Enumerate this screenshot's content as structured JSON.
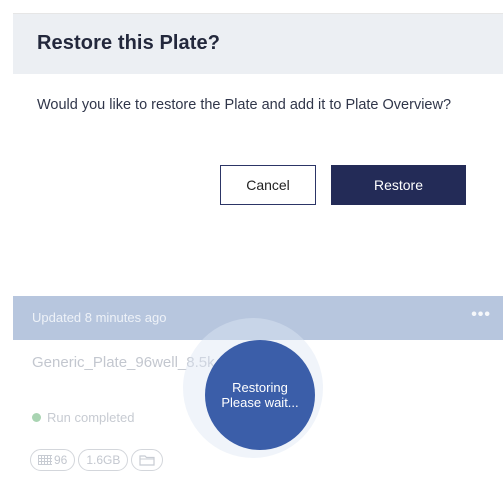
{
  "dialog": {
    "title": "Restore this Plate?",
    "message": "Would you like to restore the Plate and add it to Plate Overview?",
    "cancel_label": "Cancel",
    "restore_label": "Restore"
  },
  "plate_card": {
    "updated": "Updated 8 minutes ago",
    "menu_glyph": "•••",
    "name": "Generic_Plate_96well_8.5k",
    "status": "Run completed",
    "chips": {
      "wells": "96",
      "size": "1.6GB",
      "folder_icon": "folder-icon",
      "grid_icon": "grid-icon"
    }
  },
  "restoring": {
    "line1": "Restoring",
    "line2": "Please wait..."
  },
  "colors": {
    "primary": "#232b57",
    "card_header": "#b7c6de",
    "spinner": "#3b5ea9",
    "status_ok": "#a9d4b2"
  }
}
